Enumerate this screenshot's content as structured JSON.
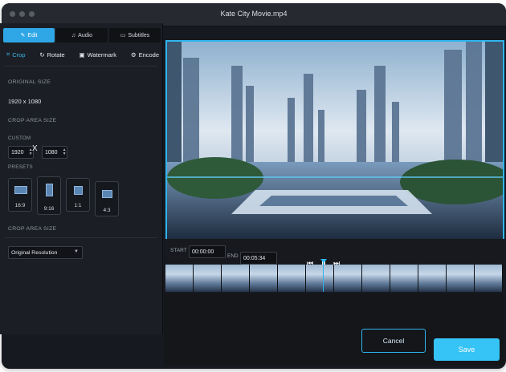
{
  "window": {
    "title": "Kate City Movie.mp4"
  },
  "tabs": [
    {
      "label": "Edit",
      "icon": "edit-icon"
    },
    {
      "label": "Audio",
      "icon": "audio-icon"
    },
    {
      "label": "Subtitles",
      "icon": "subtitles-icon"
    }
  ],
  "tools": [
    {
      "label": "Crop",
      "icon": "crop-icon"
    },
    {
      "label": "Rotate",
      "icon": "rotate-icon"
    },
    {
      "label": "Watermark",
      "icon": "watermark-icon"
    },
    {
      "label": "Encode",
      "icon": "encode-icon"
    }
  ],
  "crop": {
    "original_size_label": "ORIGINAL SIZE",
    "original_size_value": "1920 x 1080",
    "crop_area_label": "CROP AREA SIZE",
    "custom_label": "CUSTOM",
    "width": "1920",
    "height": "1080",
    "x_sign": "X",
    "presets_label": "PRESETS",
    "presets": [
      "16:9",
      "9:16",
      "1:1",
      "4:3"
    ],
    "crop_area_label_2": "CROP AREA SIZE",
    "resolution_option": "Original Resolution"
  },
  "player": {
    "start_label": "START",
    "start_time": "00:00:00",
    "end_label": "END",
    "end_time": "00:05:34"
  },
  "colors": {
    "accent": "#2fb4ee",
    "save": "#36c3f5"
  },
  "actions": {
    "cancel": "Cancel",
    "save": "Save"
  }
}
